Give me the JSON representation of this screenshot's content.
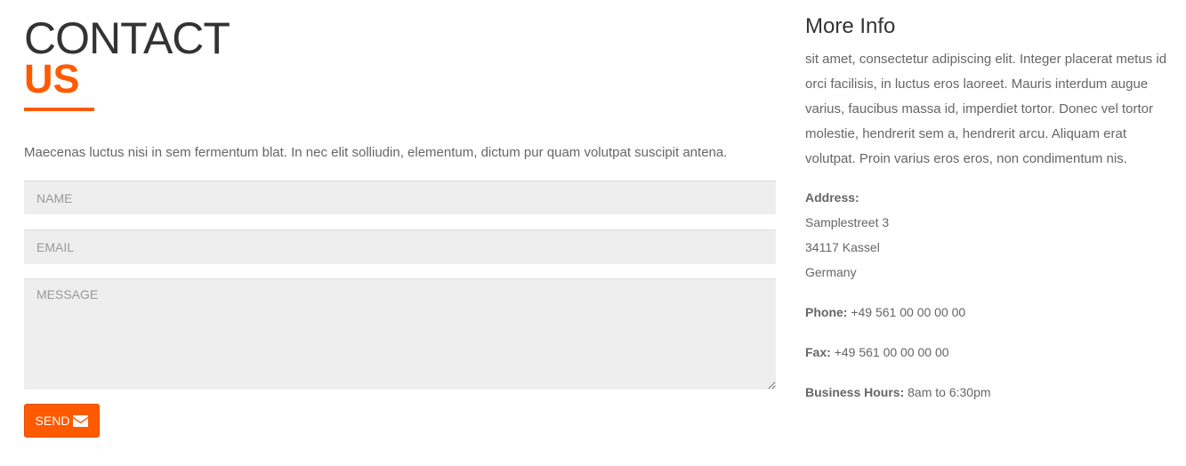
{
  "contact": {
    "heading_line1": "CONTACT",
    "heading_line2": "US",
    "intro": "Maecenas luctus nisi in sem fermentum blat. In nec elit solliudin, elementum, dictum pur quam volutpat suscipit antena.",
    "form": {
      "name_placeholder": "NAME",
      "email_placeholder": "EMAIL",
      "message_placeholder": "MESSAGE",
      "send_label": "SEND",
      "send_icon": "envelope-icon"
    }
  },
  "more_info": {
    "title": "More Info",
    "text": "sit amet, consectetur adipiscing elit. Integer placerat metus id orci facilisis, in luctus eros laoreet. Mauris interdum augue varius, faucibus massa id, imperdiet tortor. Donec vel tortor molestie, hendrerit sem a, hendrerit arcu. Aliquam erat volutpat. Proin varius eros eros, non condimentum nis.",
    "address_label": "Address:",
    "address_lines": [
      "Samplestreet 3",
      "34117 Kassel",
      "Germany"
    ],
    "phone_label": "Phone:",
    "phone_value": "+49 561 00 00 00 00",
    "fax_label": "Fax:",
    "fax_value": "+49 561 00 00 00 00",
    "hours_label": "Business Hours:",
    "hours_value": "8am to 6:30pm"
  },
  "colors": {
    "accent": "#ff5a00",
    "field_bg": "#eeeeee",
    "heading": "#333333",
    "body_text": "#666666"
  }
}
